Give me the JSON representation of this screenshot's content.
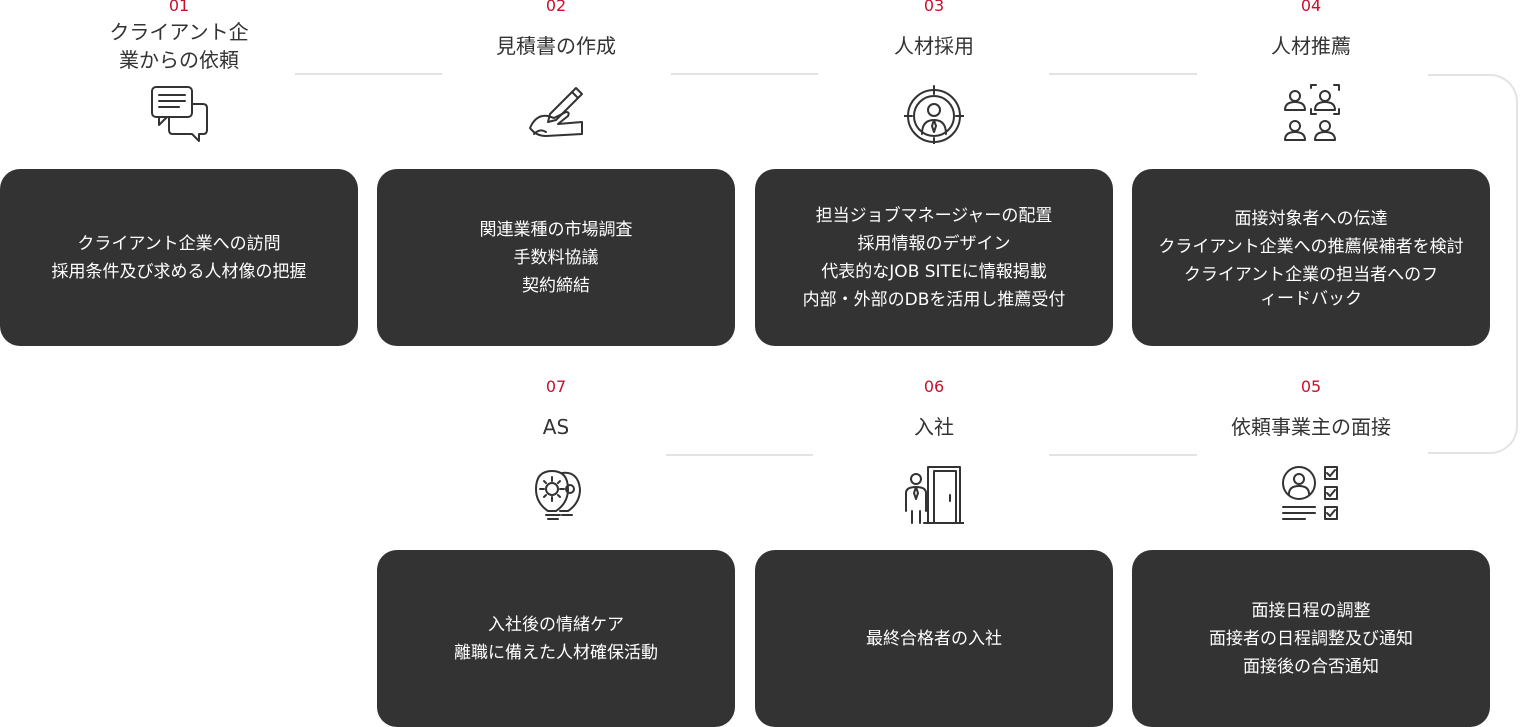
{
  "steps": [
    {
      "number": "01",
      "title": "クライアント企\n業からの依頼",
      "icon": "chat-bubbles-icon",
      "lines": [
        "クライアント企業への訪問",
        "採用条件及び求める人材像の把握"
      ]
    },
    {
      "number": "02",
      "title": "見積書の作成",
      "icon": "writing-hand-icon",
      "lines": [
        "関連業種の市場調査",
        "手数料協議",
        "契約締結"
      ]
    },
    {
      "number": "03",
      "title": "人材採用",
      "icon": "target-person-icon",
      "lines": [
        "担当ジョブマネージャーの配置",
        "採用情報のデザイン",
        "代表的なJOB SITEに情報掲載",
        "内部・外部のDBを活用し推薦受付"
      ]
    },
    {
      "number": "04",
      "title": "人材推薦",
      "icon": "people-select-icon",
      "lines": [
        "面接対象者への伝達",
        "クライアント企業への推薦候補者を検討",
        "クライアント企業の担当者へのフ\nィードバック"
      ]
    },
    {
      "number": "05",
      "title": "依頼事業主の面接",
      "icon": "checklist-person-icon",
      "lines": [
        "面接日程の調整",
        "面接者の日程調整及び通知",
        "面接後の合否通知"
      ]
    },
    {
      "number": "06",
      "title": "入社",
      "icon": "person-door-icon",
      "lines": [
        "最終合格者の入社"
      ]
    },
    {
      "number": "07",
      "title": "AS",
      "icon": "lightbulb-gears-icon",
      "lines": [
        "入社後の情緒ケア",
        "離職に備えた人材確保活動"
      ]
    }
  ],
  "colors": {
    "accent": "#c8102e",
    "card": "#333333",
    "connector": "#e3e3e3"
  }
}
